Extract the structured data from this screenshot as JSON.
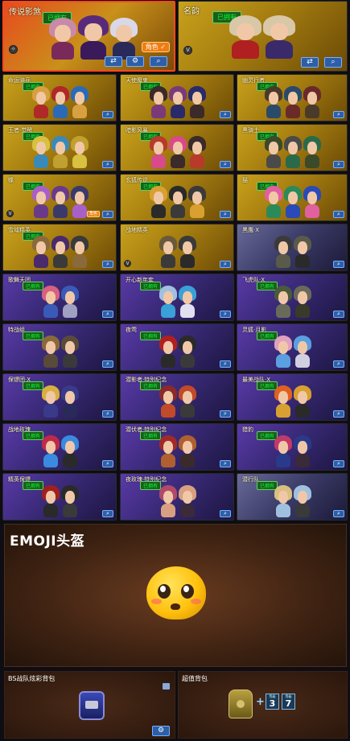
{
  "colors": {
    "gold": "#c9a21c",
    "purple": "#5a3aa8",
    "tag_green": "#5fd35f",
    "role_orange": "#f07d14",
    "button_blue": "#2c5fa8",
    "emoji_yellow": "#ffc10d"
  },
  "featured": [
    {
      "title": "传说影煞",
      "tag": "已拥有",
      "role_label": "角色",
      "role_check": "✓",
      "buttons": [
        "compare-icon",
        "gear-icon",
        "search-icon"
      ]
    },
    {
      "title": "名韵",
      "tag": "已拥有",
      "buttons": [
        "compare-icon",
        "search-icon"
      ]
    }
  ],
  "grid": [
    {
      "title": "命运骑兵",
      "tag": "已拥有"
    },
    {
      "title": "天使魔鬼",
      "tag": "已拥有"
    },
    {
      "title": "幽灵行者",
      "tag": "已拥有"
    },
    {
      "title": "王者·觉醒",
      "tag": "已拥有"
    },
    {
      "title": "暗影风暴",
      "tag": "已拥有"
    },
    {
      "title": "黑骑士",
      "tag": "已拥有"
    },
    {
      "title": "蝶",
      "tag": "已拥有",
      "role_label": "角色"
    },
    {
      "title": "玄狐传说",
      "tag": "已拥有"
    },
    {
      "title": "猫",
      "tag": "已拥有"
    },
    {
      "title": "雪域精英",
      "tag": "已拥有"
    },
    {
      "title": "战地精英",
      "tag": ""
    },
    {
      "title": "黑鹰·X",
      "tag": ""
    },
    {
      "title": "歌舞天团",
      "tag": "已拥有"
    },
    {
      "title": "开心新年套",
      "tag": "已拥有"
    },
    {
      "title": "飞虎队·X",
      "tag": "已拥有"
    },
    {
      "title": "特战组",
      "tag": "已拥有"
    },
    {
      "title": "夜莺",
      "tag": "已拥有"
    },
    {
      "title": "灵狐·月影",
      "tag": "已拥有"
    },
    {
      "title": "保镖团·X",
      "tag": "已拥有"
    },
    {
      "title": "潜影者·特别纪念",
      "tag": "已拥有"
    },
    {
      "title": "最美战队·X",
      "tag": "已拥有"
    },
    {
      "title": "战地玫瑰",
      "tag": "已拥有"
    },
    {
      "title": "潜伏者·特别纪念",
      "tag": "已拥有"
    },
    {
      "title": "猎豹",
      "tag": "已拥有"
    },
    {
      "title": "精英保镖",
      "tag": "已拥有"
    },
    {
      "title": "夜玫瑰·特别纪念",
      "tag": "已拥有"
    },
    {
      "title": "潜行队",
      "tag": "已拥有"
    }
  ],
  "emoji": {
    "title": "EMOJI头盔"
  },
  "bags": [
    {
      "title": "BS战队炫彩背包",
      "icon": "backpack-icon"
    },
    {
      "title": "超值背包",
      "icon": "armor-bag-icon",
      "plus": "+",
      "level_a": "3",
      "level_b": "7",
      "mini_a": "等级",
      "mini_b": "等级"
    }
  ]
}
